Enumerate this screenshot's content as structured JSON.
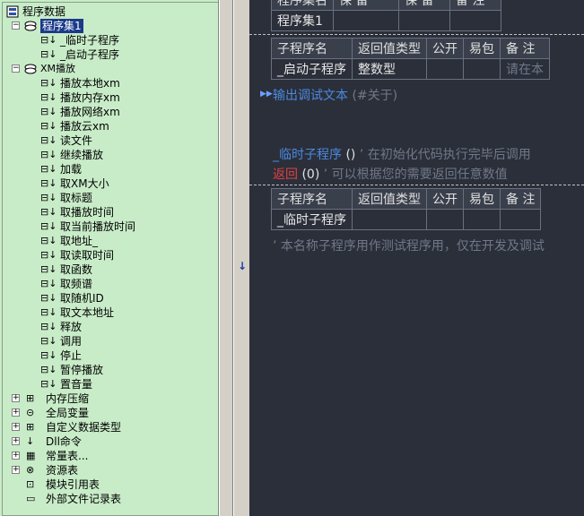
{
  "tree": {
    "root": "程序数据",
    "assembly": "程序集1",
    "assembly_children": [
      "_临时子程序",
      "_启动子程序"
    ],
    "module": "XM播放",
    "module_children": [
      "播放本地xm",
      "播放内存xm",
      "播放网络xm",
      "播放云xm",
      "读文件",
      "继续播放",
      "加载",
      "取XM大小",
      "取标题",
      "取播放时间",
      "取当前播放时间",
      "取地址_",
      "取读取时间",
      "取函数",
      "取频谱",
      "取随机ID",
      "取文本地址",
      "释放",
      "调用",
      "停止",
      "暂停播放",
      "置音量"
    ],
    "other_nodes": [
      "内存压缩",
      "全局变量",
      "自定义数据类型",
      "Dll命令",
      "常量表...",
      "资源表",
      "模块引用表",
      "外部文件记录表"
    ]
  },
  "code": {
    "top_table": {
      "headers": [
        "程序集名",
        "保 留",
        "保 留",
        "备 注"
      ],
      "row": [
        "程序集1",
        "",
        "",
        ""
      ]
    },
    "sub1_table": {
      "headers": [
        "子程序名",
        "返回值类型",
        "公开",
        "易包",
        "备 注"
      ],
      "row": [
        "_启动子程序",
        "整数型",
        "",
        "",
        "请在本"
      ]
    },
    "line_output": "输出调试文本",
    "line_output_arg": "(#关于)",
    "sub2_decl": "_临时子程序",
    "sub2_parens": "()",
    "sub2_comment": "’ 在初始化代码执行完毕后调用",
    "return_kw": "返回",
    "return_arg": "(0)",
    "return_comment": "’ 可以根据您的需要返回任意数值",
    "sub2_table": {
      "headers": [
        "子程序名",
        "返回值类型",
        "公开",
        "易包",
        "备 注"
      ],
      "row": [
        "_临时子程序",
        "",
        "",
        "",
        ""
      ]
    },
    "sub2_note": "’ 本名称子程序用作测试程序用，仅在开发及调试"
  },
  "splitter": {
    "arrow": "↓"
  },
  "colors": {
    "tree_bg": "#c8ecc8",
    "code_bg": "#2b2f3a",
    "keyword_blue": "#4a8ae0",
    "keyword_red": "#e04040",
    "comment_grey": "#707888"
  }
}
